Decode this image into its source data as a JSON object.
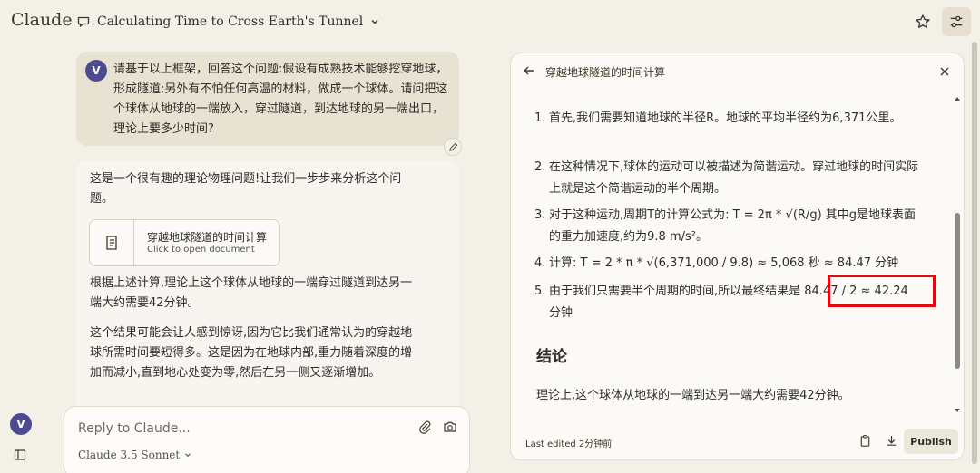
{
  "app": {
    "logo": "Claude"
  },
  "header": {
    "chat_title": "Calculating Time to Cross Earth's Tunnel"
  },
  "user_message": {
    "avatar_letter": "V",
    "text": "请基于以上框架，回答这个问题:假设有成熟技术能够挖穿地球，形成隧道;另外有不怕任何高温的材料，做成一个球体。请问把这个球体从地球的一端放入，穿过隧道，到达地球的另一端出口，理论上要多少时间?"
  },
  "assistant_message": {
    "intro": "这是一个很有趣的理论物理问题!让我们一步步来分析这个问题。",
    "doc_card": {
      "title": "穿越地球隧道的时间计算",
      "subtitle": "Click to open document"
    },
    "paragraph_1": "根据上述计算,理论上这个球体从地球的一端穿过隧道到达另一端大约需要42分钟。",
    "paragraph_2": "这个结果可能会让人感到惊讶,因为它比我们通常认为的穿越地球所需时间要短得多。这是因为在地球内部,重力随着深度的增加而减小,直到地心处变为零,然后在另一侧又逐渐增加。"
  },
  "composer": {
    "placeholder": "Reply to Claude...",
    "model": "Claude 3.5 Sonnet"
  },
  "bottom_avatar_letter": "V",
  "artifact": {
    "title": "穿越地球隧道的时间计算",
    "steps": [
      {
        "num": "1.",
        "text": "首先,我们需要知道地球的半径R。地球的平均半径约为6,371公里。"
      },
      {
        "num": "2.",
        "text": "在这种情况下,球体的运动可以被描述为简谐运动。穿过地球的时间实际上就是这个简谐运动的半个周期。"
      },
      {
        "num": "3.",
        "text": "对于这种运动,周期T的计算公式为: T = 2π * √(R/g) 其中g是地球表面的重力加速度,约为9.8 m/s²。"
      },
      {
        "num": "4.",
        "text": "计算: T = 2 * π * √(6,371,000 / 9.8) ≈ 5,068 秒 ≈ 84.47 分钟"
      },
      {
        "num": "5.",
        "text": "由于我们只需要半个周期的时间,所以最终结果是 84.47 / 2 ≈ 42.24 分钟"
      }
    ],
    "conclusion_heading": "结论",
    "conclusion_text": "理论上,这个球体从地球的一端到达另一端大约需要42分钟。",
    "last_edited": "Last edited 2分钟前",
    "publish_label": "Publish"
  },
  "colors": {
    "background": "#f3f0e8",
    "avatar": "#4e4a8f",
    "highlight": "#e00b12"
  }
}
